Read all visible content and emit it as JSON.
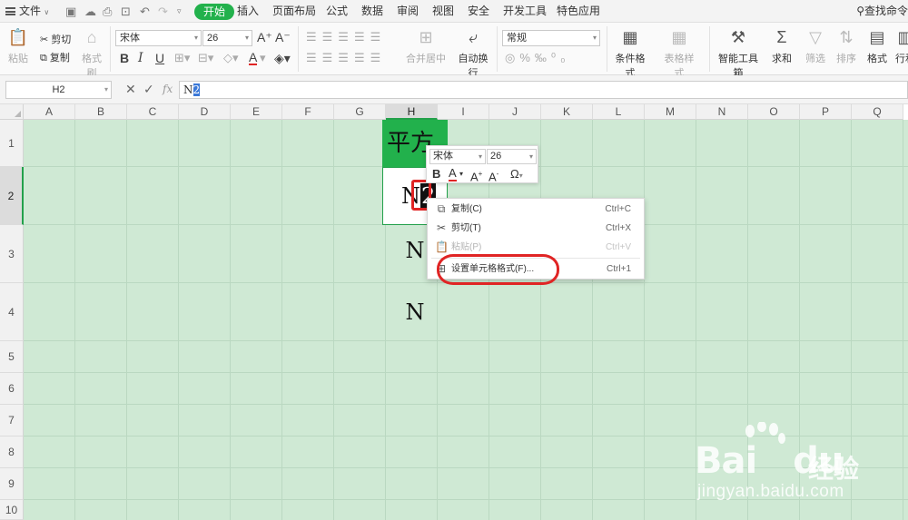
{
  "menubar": {
    "file_label": "文件",
    "tabs": [
      "开始",
      "插入",
      "页面布局",
      "公式",
      "数据",
      "审阅",
      "视图",
      "安全",
      "开发工具",
      "特色应用"
    ],
    "active_tab": "开始",
    "search_label": "查找命令"
  },
  "ribbon": {
    "paste_label": "粘贴",
    "cut_label": "剪切",
    "copy_label": "复制",
    "format_painter_label": "格式刷",
    "font_name": "宋体",
    "font_size": "26",
    "merge_center_label": "合并居中",
    "wrap_text_label": "自动换行",
    "number_format": "常规",
    "conditional_format_label": "条件格式",
    "table_style_label": "表格样式",
    "smart_toolbox_label": "智能工具箱",
    "sum_label": "求和",
    "filter_label": "筛选",
    "sort_label": "排序",
    "format_label": "格式",
    "rowcol_label": "行和"
  },
  "formula_bar": {
    "name_box": "H2",
    "fx_label": "fx",
    "content_prefix": "N",
    "content_selected": "2"
  },
  "grid": {
    "columns": [
      "A",
      "B",
      "C",
      "D",
      "E",
      "F",
      "G",
      "H",
      "I",
      "J",
      "K",
      "L",
      "M",
      "N",
      "O",
      "P",
      "Q"
    ],
    "active_column": "H",
    "rows": [
      "1",
      "2",
      "3",
      "4",
      "5",
      "6",
      "7",
      "8",
      "9",
      "10"
    ],
    "active_row": "2",
    "cell_h1": "平方",
    "cell_h2_prefix": "N",
    "cell_h2_cursor": "2",
    "cell_h3": "N",
    "cell_h4": "N"
  },
  "mini_toolbar": {
    "font_name": "宋体",
    "font_size": "26",
    "bold": "B",
    "font_color": "A",
    "grow": "A",
    "shrink": "A",
    "symbol": "Ω"
  },
  "context_menu": {
    "items": [
      {
        "label": "复制(C)",
        "shortcut": "Ctrl+C",
        "icon": "copy-icon",
        "enabled": true
      },
      {
        "label": "剪切(T)",
        "shortcut": "Ctrl+X",
        "icon": "scissors-icon",
        "enabled": true
      },
      {
        "label": "粘贴(P)",
        "shortcut": "Ctrl+V",
        "icon": "paste-icon",
        "enabled": false
      },
      {
        "label": "设置单元格格式(F)...",
        "shortcut": "Ctrl+1",
        "icon": "format-cells-icon",
        "enabled": true
      }
    ]
  },
  "colors": {
    "accent": "#22b14c",
    "sheet_bg": "#cfe9d4",
    "highlight": "#e02424"
  },
  "watermark": {
    "logo": "Baidu",
    "cn": "经验",
    "url": "jingyan.baidu.com"
  }
}
